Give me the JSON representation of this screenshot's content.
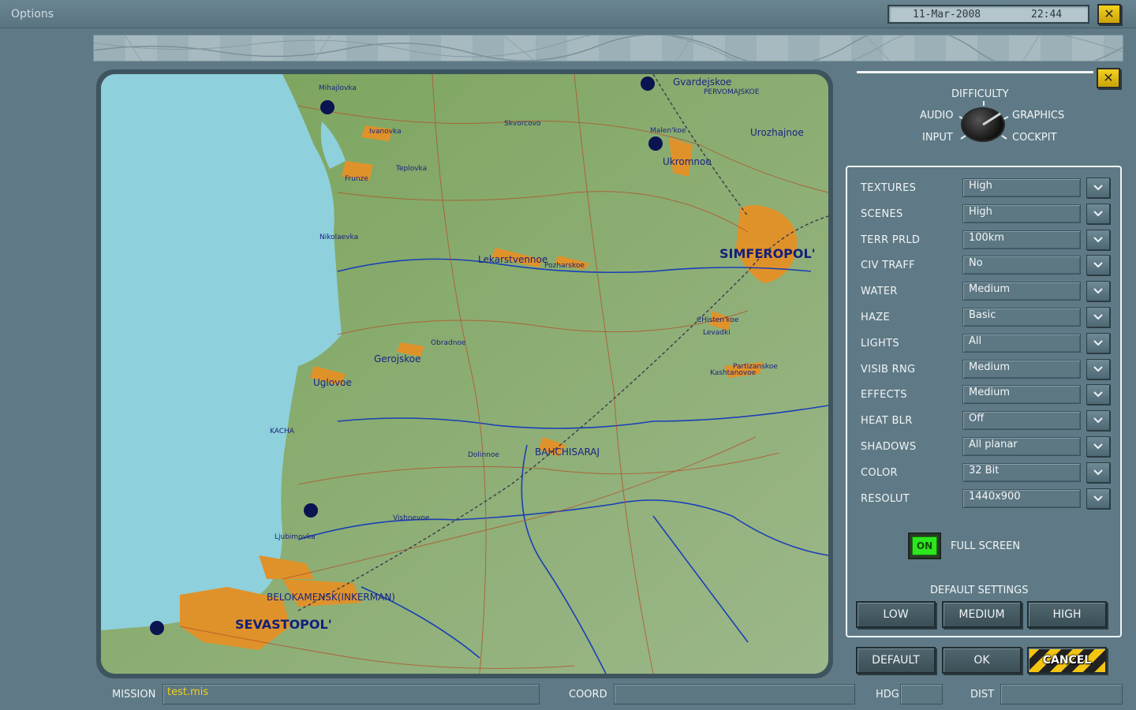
{
  "window": {
    "title": "Options",
    "date": "11-Mar-2008",
    "time": "22:44",
    "close_label": "✕"
  },
  "map": {
    "labels": {
      "mihajlovka": "Mihajlovka",
      "ivanovka": "Ivanovka",
      "teplovka": "Teplovka",
      "frunze": "Frunze",
      "nikolaevka": "Nikolaevka",
      "skvorcovo": "Skvorcovo",
      "gvardejskoe": "Gvardejskoe",
      "pervomajskoe": "PERVOMAJSKOE",
      "malenkoe": "Malen'koe",
      "ukromnoe": "Ukromnoe",
      "urozhajnoe": "Urozhajnoe",
      "simferopol": "SIMFEROPOL'",
      "lekarstvennoe": "Lekarstvennoe",
      "pozharskoe": "Pozharskoe",
      "chistenkoe": "CHisten'koe",
      "levadki": "Levadki",
      "partizanskoe": "Partizanskoe",
      "kashtanovoe": "Kashtanovoe",
      "obrodnoe": "Obradnoe",
      "gerojskoe": "Gerojskoe",
      "uglovoe": "Uglovoe",
      "kacha": "KACHA",
      "dolinnoe": "Dolinnoe",
      "bahchisaraj": "BAHCHISARAJ",
      "vishnevoe": "Vishnevoe",
      "ljubimovka": "Ljubimovka",
      "belokamensk": "BELOKAMENSK(INKERMAN)",
      "sevastopol": "SEVASTOPOL'"
    }
  },
  "panel": {
    "close_label": "✕",
    "difficulty": {
      "title": "DIFFICULTY",
      "audio": "AUDIO",
      "graphics": "GRAPHICS",
      "input": "INPUT",
      "cockpit": "COCKPIT"
    },
    "settings": [
      {
        "label": "TEXTURES",
        "value": "High"
      },
      {
        "label": "SCENES",
        "value": "High"
      },
      {
        "label": "TERR PRLD",
        "value": "100km"
      },
      {
        "label": "CIV TRAFF",
        "value": "No"
      },
      {
        "label": "WATER",
        "value": "Medium"
      },
      {
        "label": "HAZE",
        "value": "Basic"
      },
      {
        "label": "LIGHTS",
        "value": "All"
      },
      {
        "label": "VISIB RNG",
        "value": "Medium"
      },
      {
        "label": "EFFECTS",
        "value": "Medium"
      },
      {
        "label": "HEAT BLR",
        "value": "Off"
      },
      {
        "label": "SHADOWS",
        "value": "All planar"
      },
      {
        "label": "COLOR",
        "value": "32 Bit"
      },
      {
        "label": "RESOLUT",
        "value": "1440x900"
      }
    ],
    "fullscreen": {
      "toggle": "ON",
      "label": "FULL SCREEN"
    },
    "default_settings": {
      "title": "DEFAULT SETTINGS",
      "low": "LOW",
      "medium": "MEDIUM",
      "high": "HIGH"
    },
    "actions": {
      "default": "DEFAULT",
      "ok": "OK",
      "cancel": "CANCEL"
    }
  },
  "status": {
    "mission_label": "MISSION",
    "mission_value": "test.mis",
    "coord_label": "COORD",
    "hdg_label": "HDG",
    "dist_label": "DIST"
  }
}
